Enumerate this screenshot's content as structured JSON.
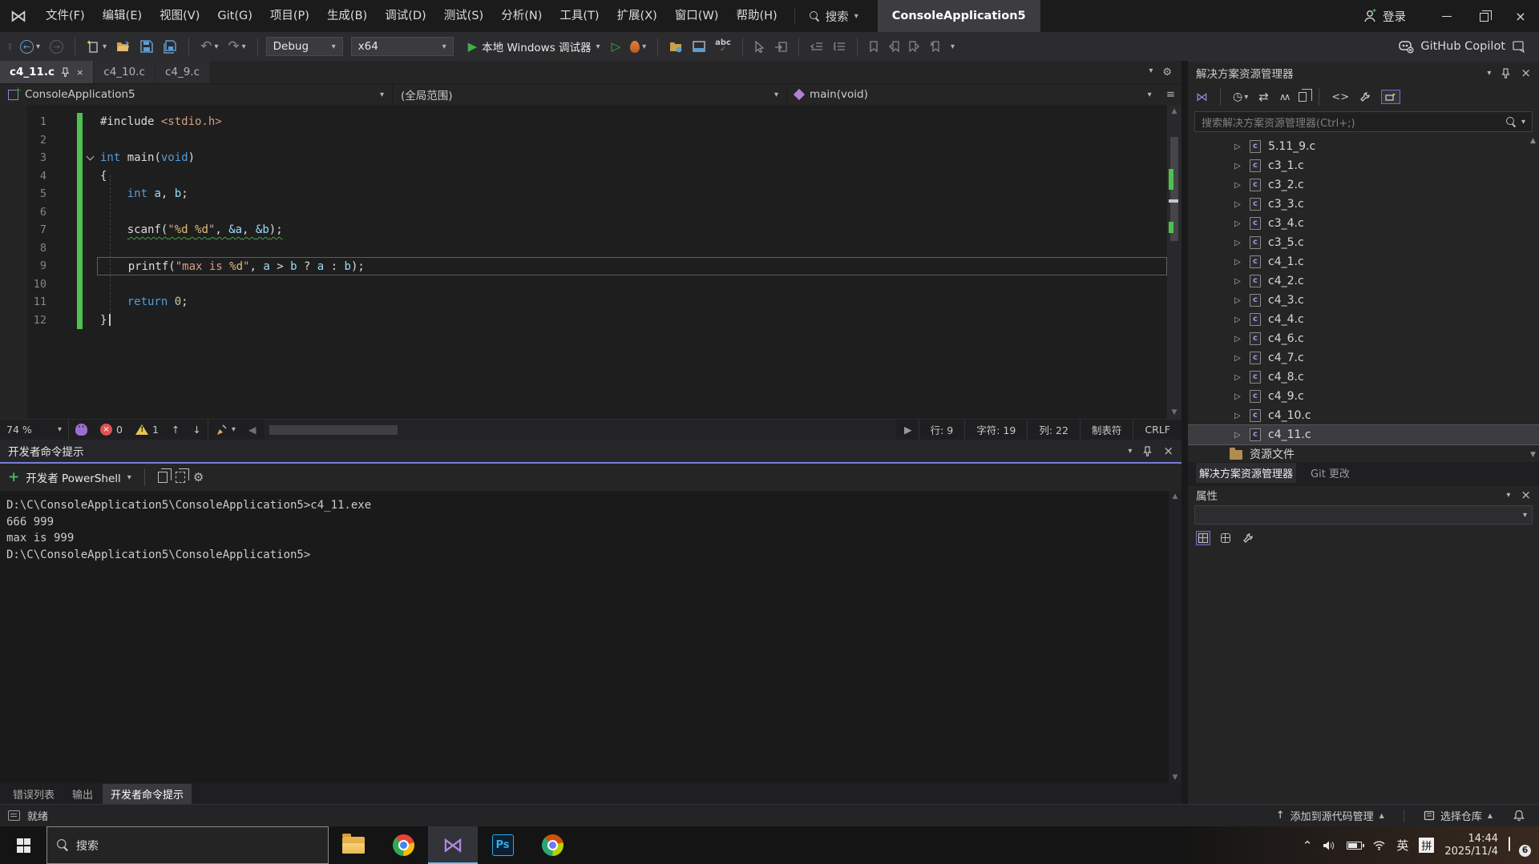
{
  "window": {
    "search_label": "搜索",
    "project_title": "ConsoleApplication5",
    "sign_in": "登录"
  },
  "menu": [
    "文件(F)",
    "编辑(E)",
    "视图(V)",
    "Git(G)",
    "项目(P)",
    "生成(B)",
    "调试(D)",
    "测试(S)",
    "分析(N)",
    "工具(T)",
    "扩展(X)",
    "窗口(W)",
    "帮助(H)"
  ],
  "toolbar": {
    "config": "Debug",
    "platform": "x64",
    "run_label": "本地 Windows 调试器",
    "copilot_label": "GitHub Copilot"
  },
  "tabs": [
    {
      "label": "c4_11.c",
      "active": true
    },
    {
      "label": "c4_10.c",
      "active": false
    },
    {
      "label": "c4_9.c",
      "active": false
    }
  ],
  "navbar": {
    "project": "ConsoleApplication5",
    "scope": "(全局范围)",
    "member": "main(void)"
  },
  "editor": {
    "lines": [
      {
        "tokens": [
          {
            "c": "p",
            "t": "#include "
          },
          {
            "c": "s",
            "t": "<stdio.h>"
          }
        ]
      },
      {
        "tokens": []
      },
      {
        "fold": true,
        "tokens": [
          {
            "c": "k",
            "t": "int"
          },
          {
            "c": "p",
            "t": " main("
          },
          {
            "c": "k",
            "t": "void"
          },
          {
            "c": "p",
            "t": ")"
          }
        ]
      },
      {
        "tokens": [
          {
            "c": "p",
            "t": "{"
          }
        ]
      },
      {
        "tokens": [
          {
            "c": "p",
            "t": "    "
          },
          {
            "c": "k",
            "t": "int"
          },
          {
            "c": "p",
            "t": " "
          },
          {
            "c": "v",
            "t": "a"
          },
          {
            "c": "p",
            "t": ", "
          },
          {
            "c": "v",
            "t": "b"
          },
          {
            "c": "p",
            "t": ";"
          }
        ]
      },
      {
        "tokens": []
      },
      {
        "indent": "    ",
        "squiggle": true,
        "tokens": [
          {
            "c": "p",
            "t": "scanf("
          },
          {
            "c": "s",
            "t": "\""
          },
          {
            "c": "f",
            "t": "%d"
          },
          {
            "c": "s",
            "t": " "
          },
          {
            "c": "f",
            "t": "%d"
          },
          {
            "c": "s",
            "t": "\""
          },
          {
            "c": "p",
            "t": ", "
          },
          {
            "c": "v",
            "t": "&a"
          },
          {
            "c": "p",
            "t": ", "
          },
          {
            "c": "v",
            "t": "&b"
          },
          {
            "c": "p",
            "t": ");"
          }
        ]
      },
      {
        "tokens": []
      },
      {
        "indent": "    ",
        "current": true,
        "tokens": [
          {
            "c": "p",
            "t": "printf("
          },
          {
            "c": "s",
            "t": "\"max is "
          },
          {
            "c": "f",
            "t": "%d"
          },
          {
            "c": "s",
            "t": "\""
          },
          {
            "c": "p",
            "t": ", "
          },
          {
            "c": "v",
            "t": "a"
          },
          {
            "c": "p",
            "t": " > "
          },
          {
            "c": "v",
            "t": "b"
          },
          {
            "c": "p",
            "t": " ? "
          },
          {
            "c": "v",
            "t": "a"
          },
          {
            "c": "p",
            "t": " : "
          },
          {
            "c": "v",
            "t": "b"
          },
          {
            "c": "p",
            "t": ");"
          }
        ]
      },
      {
        "tokens": []
      },
      {
        "tokens": [
          {
            "c": "p",
            "t": "    "
          },
          {
            "c": "k",
            "t": "return"
          },
          {
            "c": "p",
            "t": " "
          },
          {
            "c": "n",
            "t": "0"
          },
          {
            "c": "p",
            "t": ";"
          }
        ]
      },
      {
        "caret": true,
        "tokens": [
          {
            "c": "p",
            "t": "}"
          }
        ]
      }
    ]
  },
  "editor_status": {
    "zoom": "74 %",
    "errors": "0",
    "warnings": "1",
    "line": "行: 9",
    "char": "字符: 19",
    "col": "列: 22",
    "tabs": "制表符",
    "eol": "CRLF"
  },
  "terminal": {
    "title": "开发者命令提示",
    "shell_button": "开发者 PowerShell",
    "lines": [
      "D:\\C\\ConsoleApplication5\\ConsoleApplication5>c4_11.exe",
      "666 999",
      "max is 999",
      "D:\\C\\ConsoleApplication5\\ConsoleApplication5>"
    ]
  },
  "bottom_tabs": [
    {
      "label": "错误列表",
      "active": false
    },
    {
      "label": "输出",
      "active": false
    },
    {
      "label": "开发者命令提示",
      "active": true
    }
  ],
  "status_bar": {
    "ready": "就绪",
    "add_to_source": "添加到源代码管理",
    "select_repo": "选择仓库"
  },
  "solution_explorer": {
    "title": "解决方案资源管理器",
    "search_placeholder": "搜索解决方案资源管理器(Ctrl+;)",
    "files": [
      "5.11_9.c",
      "c3_1.c",
      "c3_2.c",
      "c3_3.c",
      "c3_4.c",
      "c3_5.c",
      "c4_1.c",
      "c4_2.c",
      "c4_3.c",
      "c4_4.c",
      "c4_6.c",
      "c4_7.c",
      "c4_8.c",
      "c4_9.c",
      "c4_10.c",
      "c4_11.c"
    ],
    "selected_file": "c4_11.c",
    "folder": "资源文件",
    "bottom_tabs": [
      {
        "label": "解决方案资源管理器",
        "active": true
      },
      {
        "label": "Git 更改",
        "active": false
      }
    ]
  },
  "properties": {
    "title": "属性"
  },
  "taskbar": {
    "search": "搜索",
    "lang_en": "英",
    "lang_pinyin": "拼",
    "time": "14:44",
    "date": "2025/11/4",
    "notif_count": "6"
  },
  "icons": {
    "vs_logo": "⋈",
    "chevron_down": "▾",
    "close": "×",
    "search": "magnifier-css",
    "run": "▶",
    "run_no_debug": "▷",
    "undo": "↶",
    "redo": "↷",
    "back": "←",
    "forward": "→",
    "up_arrow": "↑",
    "down_arrow": "↓",
    "scroll_up": "▲",
    "scroll_down": "▼",
    "scroll_left": "◀",
    "scroll_right": "▶",
    "tree_collapsed": "▷",
    "gear": "⚙",
    "sync": "⇄",
    "collapse_all": "∧"
  },
  "colors": {
    "accent_run": "#3fae46",
    "change_bar": "#4fc14f",
    "focus_line": "#7b7bd5",
    "keyword": "#569cd6",
    "string": "#d69d85",
    "variable": "#9cdcfe",
    "number": "#b5cea8",
    "error_red": "#e05252",
    "warning_yellow": "#e8c15a",
    "selected_tab": "#3e3e42"
  }
}
